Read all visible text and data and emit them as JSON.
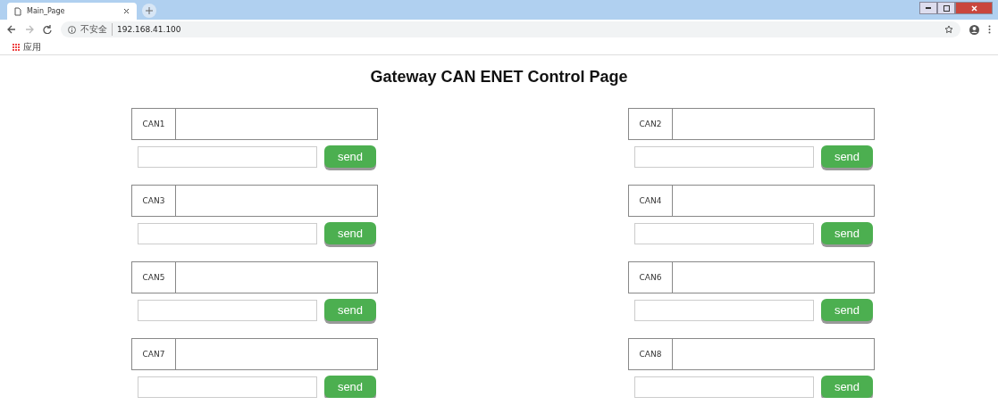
{
  "browser": {
    "tab_title": "Main_Page",
    "security_label": "不安全",
    "url": "192.168.41.100",
    "apps_label": "应用"
  },
  "title": "Gateway CAN ENET Control Page",
  "channels": [
    {
      "label": "CAN1",
      "button": "send"
    },
    {
      "label": "CAN2",
      "button": "send"
    },
    {
      "label": "CAN3",
      "button": "send"
    },
    {
      "label": "CAN4",
      "button": "send"
    },
    {
      "label": "CAN5",
      "button": "send"
    },
    {
      "label": "CAN6",
      "button": "send"
    },
    {
      "label": "CAN7",
      "button": "send"
    },
    {
      "label": "CAN8",
      "button": "send"
    }
  ]
}
